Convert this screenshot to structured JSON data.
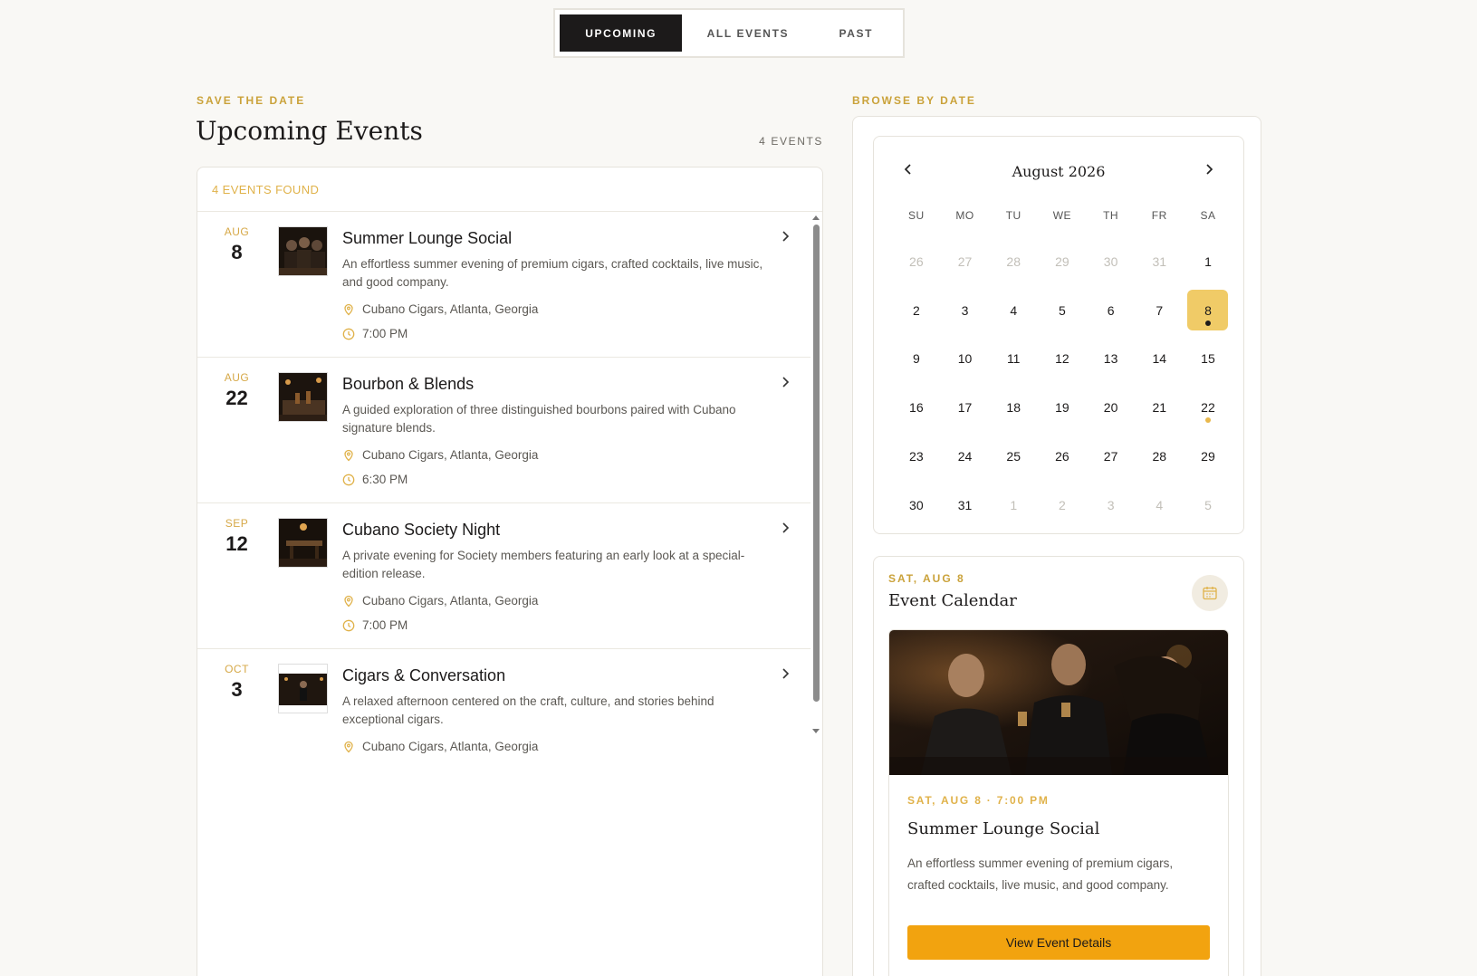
{
  "tabs": [
    {
      "label": "UPCOMING",
      "active": true
    },
    {
      "label": "ALL EVENTS",
      "active": false
    },
    {
      "label": "PAST",
      "active": false
    }
  ],
  "left": {
    "eyebrow": "SAVE THE DATE",
    "title": "Upcoming Events",
    "count": "4 EVENTS",
    "found": "4 EVENTS FOUND"
  },
  "events": [
    {
      "month": "AUG",
      "day": "8",
      "title": "Summer Lounge Social",
      "desc": "An effortless summer evening of premium cigars, crafted cocktails, live music, and good company.",
      "location": "Cubano Cigars, Atlanta, Georgia",
      "time": "7:00 PM"
    },
    {
      "month": "AUG",
      "day": "22",
      "title": "Bourbon & Blends",
      "desc": "A guided exploration of three distinguished bourbons paired with Cubano signature blends.",
      "location": "Cubano Cigars, Atlanta, Georgia",
      "time": "6:30 PM"
    },
    {
      "month": "SEP",
      "day": "12",
      "title": "Cubano Society Night",
      "desc": "A private evening for Society members featuring an early look at a special-edition release.",
      "location": "Cubano Cigars, Atlanta, Georgia",
      "time": "7:00 PM"
    },
    {
      "month": "OCT",
      "day": "3",
      "title": "Cigars & Conversation",
      "desc": "A relaxed afternoon centered on the craft, culture, and stories behind exceptional cigars.",
      "location": "Cubano Cigars, Atlanta, Georgia",
      "time": ""
    }
  ],
  "right": {
    "eyebrow": "BROWSE BY DATE",
    "month_label": "August 2026",
    "weekdays": [
      "SU",
      "MO",
      "TU",
      "WE",
      "TH",
      "FR",
      "SA"
    ],
    "days": [
      "26",
      "27",
      "28",
      "29",
      "30",
      "31",
      "1",
      "2",
      "3",
      "4",
      "5",
      "6",
      "7",
      "8",
      "9",
      "10",
      "11",
      "12",
      "13",
      "14",
      "15",
      "16",
      "17",
      "18",
      "19",
      "20",
      "21",
      "22",
      "23",
      "24",
      "25",
      "26",
      "27",
      "28",
      "29",
      "30",
      "31",
      "1",
      "2",
      "3",
      "4",
      "5"
    ],
    "muted_indices": [
      0,
      1,
      2,
      3,
      4,
      5,
      37,
      38,
      39,
      40,
      41
    ],
    "selected_index": 13,
    "dot_indices": [
      13,
      27
    ]
  },
  "day_panel": {
    "eyebrow": "SAT, AUG 8",
    "title": "Event Calendar",
    "feature": {
      "eyebrow": "SAT, AUG 8 · 7:00 PM",
      "title": "Summer Lounge Social",
      "desc": "An effortless summer evening of premium cigars, crafted cocktails, live music, and good company.",
      "button": "View Event Details"
    }
  },
  "colors": {
    "accent": "#f2a30f",
    "gold": "#caa23a",
    "dark": "#1c1a1a"
  }
}
